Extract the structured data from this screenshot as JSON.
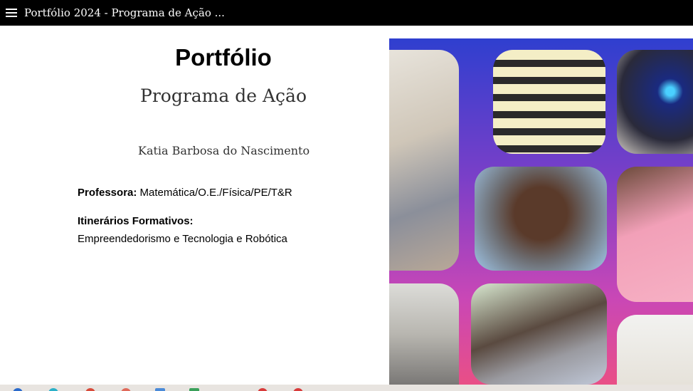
{
  "window": {
    "title": "Portfólio 2024 - Programa de Ação ..."
  },
  "slide": {
    "title": "Portfólio",
    "subtitle": "Programa de Ação",
    "author": "Katia Barbosa do Nascimento",
    "professor_label": "Professora:",
    "professor_value": " Matemática/O.E./Física/PE/T&R",
    "itinerarios_label": "Itinerários Formativos:",
    "itinerarios_value": "Empreendedorismo e Tecnologia e Robótica"
  },
  "icons": {
    "menu": "hamburger-menu-icon"
  },
  "colors": {
    "topbar": "#000000",
    "collage_top": "#2f3fcf",
    "collage_bottom": "#e94f86"
  }
}
